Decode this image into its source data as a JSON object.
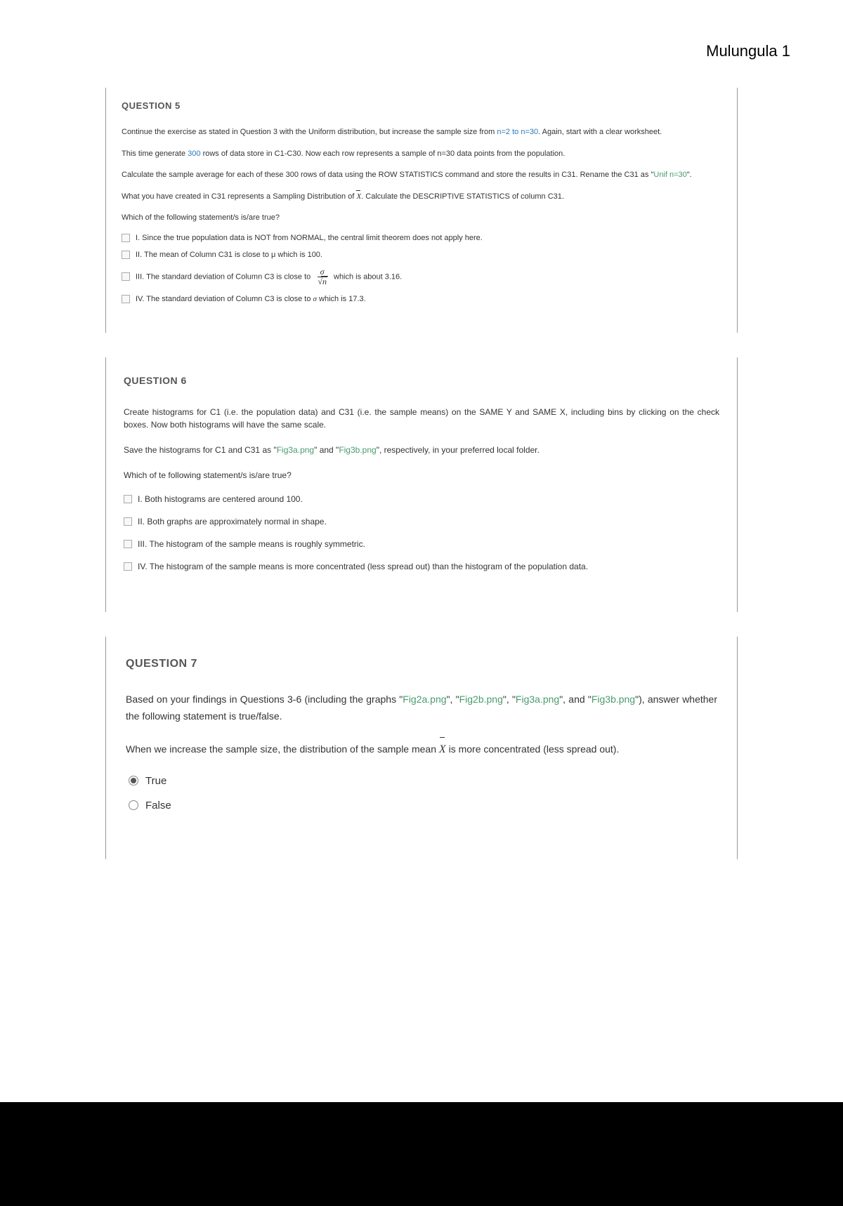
{
  "header": {
    "name": "Mulungula 1"
  },
  "q5": {
    "title": "QUESTION 5",
    "p1a": "Continue the exercise as stated in Question 3 with the Uniform distribution, but increase the sample size from ",
    "p1b": "n=2 to n=30",
    "p1c": ". Again, start with a clear worksheet.",
    "p2a": "This time generate ",
    "p2b": "300",
    "p2c": " rows of data store in C1-C30. Now each row represents a sample of n=30 data points from the population.",
    "p3a": "Calculate the sample average for each of these 300 rows of data using the ROW STATISTICS command and store the results in C31. Rename the C31 as \"",
    "p3b": "Unif n=30",
    "p3c": "\".",
    "p4a": "What you have created in C31 represents a Sampling Distribution of ",
    "p4b": ". Calculate the DESCRIPTIVE STATISTICS of column C31.",
    "p5": "Which of the following statement/s is/are true?",
    "opt1": "I.   Since the true population data is NOT from NORMAL, the central limit theorem does not apply here.",
    "opt2": "II.  The mean of Column C31 is close to μ which is 100.",
    "opt3a": "III. ",
    "opt3b": "The standard deviation of Column C3 is close to ",
    "opt3c": " which is about 3.16.",
    "opt4a": "IV. The standard deviation of Column C3 is close to ",
    "opt4b": " which is 17.3.",
    "sigma": "σ",
    "n": "n"
  },
  "q6": {
    "title": "QUESTION 6",
    "p1": "Create histograms for  C1 (i.e. the population data) and C31 (i.e. the sample means) on the SAME Y and SAME X, including bins by clicking on the check boxes. Now both histograms will have the same scale.",
    "p2a": "Save the histograms for C1 and C31 as \"",
    "p2b": "Fig3a.png",
    "p2c": "\" and \"",
    "p2d": "Fig3b.png",
    "p2e": "\", respectively, in your preferred local folder.",
    "p3": "Which of te following statement/s is/are true?",
    "opt1": "I.   Both histograms are centered around 100.",
    "opt2": "II.  Both graphs are approximately normal in shape.",
    "opt3": "III. The histogram of the sample means is roughly symmetric.",
    "opt4": "IV. The histogram of the sample means is more concentrated (less spread out) than the histogram of the population data."
  },
  "q7": {
    "title": "QUESTION 7",
    "p1a": "Based on your findings in Questions 3-6 (including the graphs \"",
    "p1b": "Fig2a.png",
    "p1c": "\", \"",
    "p1d": "Fig2b.png",
    "p1e": "\", \"",
    "p1f": "Fig3a.png",
    "p1g": "\", and \"",
    "p1h": "Fig3b.png",
    "p1i": "\"), answer whether the following statement is true/false.",
    "p2a": "When we increase the sample size, the distribution of the sample mean ",
    "p2b": " is more concentrated (less spread out).",
    "xbar": "X",
    "optTrue": "True",
    "optFalse": "False"
  }
}
